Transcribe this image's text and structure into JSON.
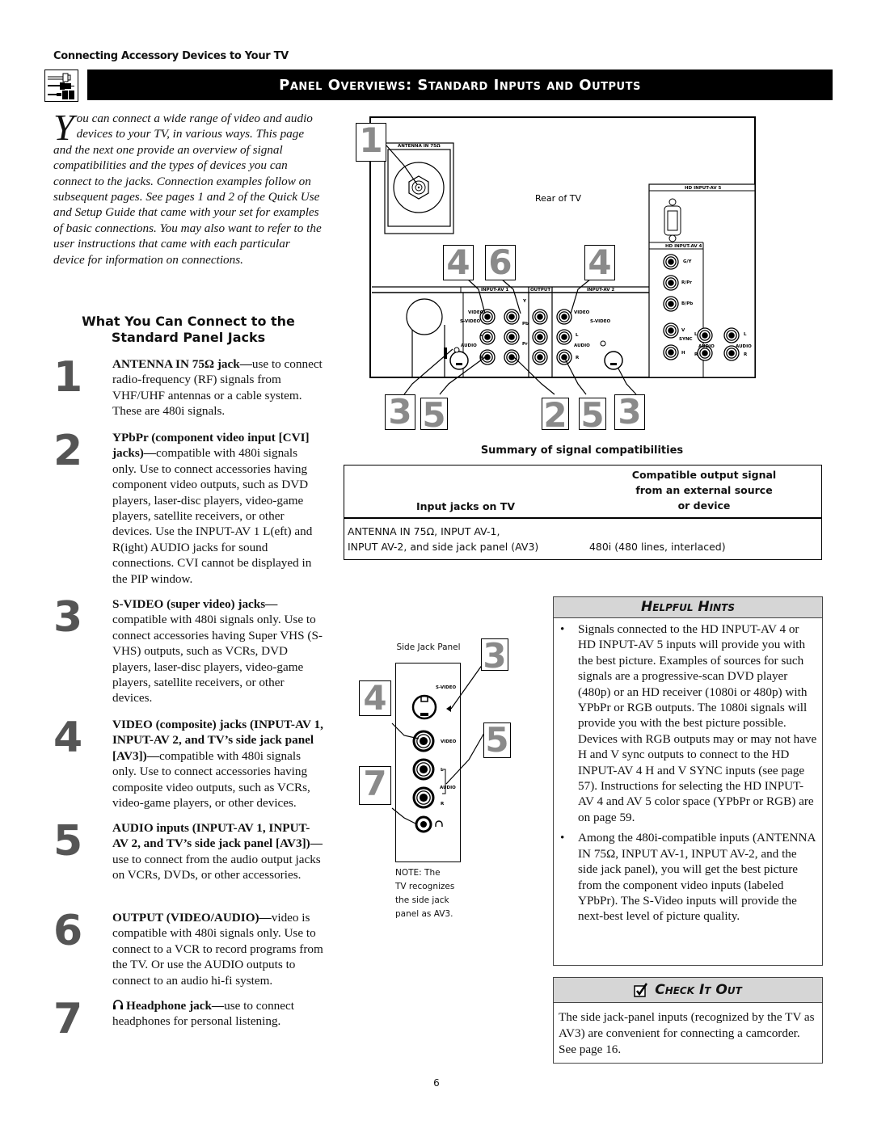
{
  "header": {
    "section_label": "Connecting Accessory Devices to Your TV",
    "banner_title": "Panel Overviews: Standard Inputs and Outputs",
    "banner_icon": "cable-connectors-icon"
  },
  "intro": {
    "drop_cap": "Y",
    "text": "ou can connect a wide range of video and audio devices to your TV, in various ways. This page and the next one provide an overview of signal compatibilities and the types of devices you can connect to the jacks. Connection examples follow on subsequent pages. See pages 1 and 2 of the Quick Use and Setup Guide that came with your set for examples of basic connections. You may also want to refer to the user instructions that came with each particular device for information on connections."
  },
  "subhead": {
    "line1": "What You Can Connect to the",
    "line2": "Standard Panel Jacks"
  },
  "items": [
    {
      "num": "1",
      "bold": "ANTENNA IN 75Ω jack—",
      "text": "use to connect radio-frequency (RF) signals from VHF/UHF antennas or a cable system. These are 480i signals."
    },
    {
      "num": "2",
      "bold": "YPbPr (component video input [CVI] jacks)—",
      "text": "compatible with 480i signals only. Use to connect accessories having component video outputs, such as DVD players, laser-disc players, video-game players, satellite receivers, or other devices. Use the INPUT-AV 1 L(eft) and R(ight) AUDIO jacks for sound connections. CVI cannot be displayed in the PIP window."
    },
    {
      "num": "3",
      "bold": "S-VIDEO (super video) jacks—",
      "text": "compatible with 480i signals only. Use to connect accessories having Super VHS (S-VHS) outputs, such as VCRs, DVD players, laser-disc players, video-game players, satellite receivers, or other devices."
    },
    {
      "num": "4",
      "bold": "VIDEO (composite) jacks (INPUT-AV 1, INPUT-AV 2, and TV’s side jack panel [AV3])—",
      "text": "compatible with 480i signals only. Use to connect accessories having composite video outputs, such as VCRs, video-game players, or other devices."
    },
    {
      "num": "5",
      "bold": "AUDIO inputs (INPUT-AV 1, INPUT-AV 2, and TV’s side jack panel [AV3])—",
      "text": "use to connect from the audio output jacks on VCRs, DVDs, or other accessories."
    },
    {
      "num": "6",
      "bold": "OUTPUT (VIDEO/AUDIO)—",
      "text": "video is compatible with 480i signals only. Use to connect to a VCR to record programs from the TV. Or use the AUDIO outputs to connect to an audio hi-fi system."
    },
    {
      "num": "7",
      "icon": "headphone-icon",
      "bold": "Headphone jack—",
      "text": "use to connect headphones for personal listening."
    }
  ],
  "rear_diagram": {
    "caption": "Rear of TV",
    "antenna_label": "ANTENNA IN 75Ω",
    "input_av1_label": "INPUT-AV 1",
    "output_label": "OUTPUT",
    "input_av2_label": "INPUT-AV 2",
    "hd_av5_label": "HD INPUT-AV 5",
    "hd_av4_label": "HD INPUT-AV 4",
    "jack_labels": {
      "video": "VIDEO",
      "svideo": "S-VIDEO",
      "l": "L",
      "r": "R",
      "audio": "AUDIO",
      "y": "Y",
      "pb": "Pb",
      "pr": "Pr",
      "gy": "G/Y",
      "rpr": "R/Pr",
      "bpb": "B/Pb",
      "v": "V",
      "h": "H",
      "sync": "SYNC"
    },
    "callouts": {
      "c1": "1",
      "c4a": "4",
      "c6": "6",
      "c4b": "4",
      "c3a": "3",
      "c5a": "5",
      "c2": "2",
      "c5b": "5",
      "c3b": "3"
    }
  },
  "summary": {
    "title": "Summary of signal compatibilities",
    "col1_header": "Input jacks on TV",
    "col2_header_lines": [
      "Compatible output signal",
      "from an external source",
      "or device"
    ],
    "rows": [
      {
        "inputs_line1": "ANTENNA IN 75Ω, INPUT AV-1,",
        "inputs_line2": "INPUT AV-2, and side jack panel (AV3)",
        "signal": "480i (480 lines, interlaced)"
      }
    ]
  },
  "side_panel": {
    "title": "Side Jack Panel",
    "labels": {
      "svideo": "S-VIDEO",
      "video": "VIDEO",
      "l": "L",
      "audio": "AUDIO",
      "r": "R"
    },
    "callouts": {
      "c3": "3",
      "c4": "4",
      "c5": "5",
      "c7": "7"
    },
    "note_lines": [
      "NOTE: The",
      "TV recognizes",
      "the side jack",
      "panel as AV3."
    ]
  },
  "helpful_hints": {
    "title": "Helpful Hints",
    "bullets": [
      "Signals connected to the HD INPUT-AV 4 or HD INPUT-AV 5 inputs will provide you with the best picture. Examples of sources for such signals are a progressive-scan DVD player (480p) or an HD receiver (1080i or 480p) with YPbPr or RGB outputs. The 1080i signals will provide you with the best picture possible. Devices with RGB outputs may or may not have H and V sync outputs to connect to the HD INPUT-AV 4 H and V SYNC inputs (see page 57). Instructions for selecting the HD INPUT-AV 4 and AV 5 color space (YPbPr or RGB) are on page 59.",
      "Among the 480i-compatible inputs (ANTENNA IN 75Ω, INPUT AV-1, INPUT AV-2, and the side jack panel), you will get the best picture from the component video inputs (labeled YPbPr). The S-Video inputs will provide the next-best level of picture quality."
    ]
  },
  "check_it_out": {
    "title": "Check It Out",
    "icon": "checkbox-checked-icon",
    "text": "The side jack-panel inputs (recognized by the TV as AV3) are convenient for connecting a camcorder. See page 16."
  },
  "footer": {
    "page_number": "6"
  },
  "colors": {
    "banner_bg": "#000000",
    "callout_digit": "#8a8a8a",
    "box_header_bg": "#d6d6d6",
    "item_number": "#555555"
  }
}
